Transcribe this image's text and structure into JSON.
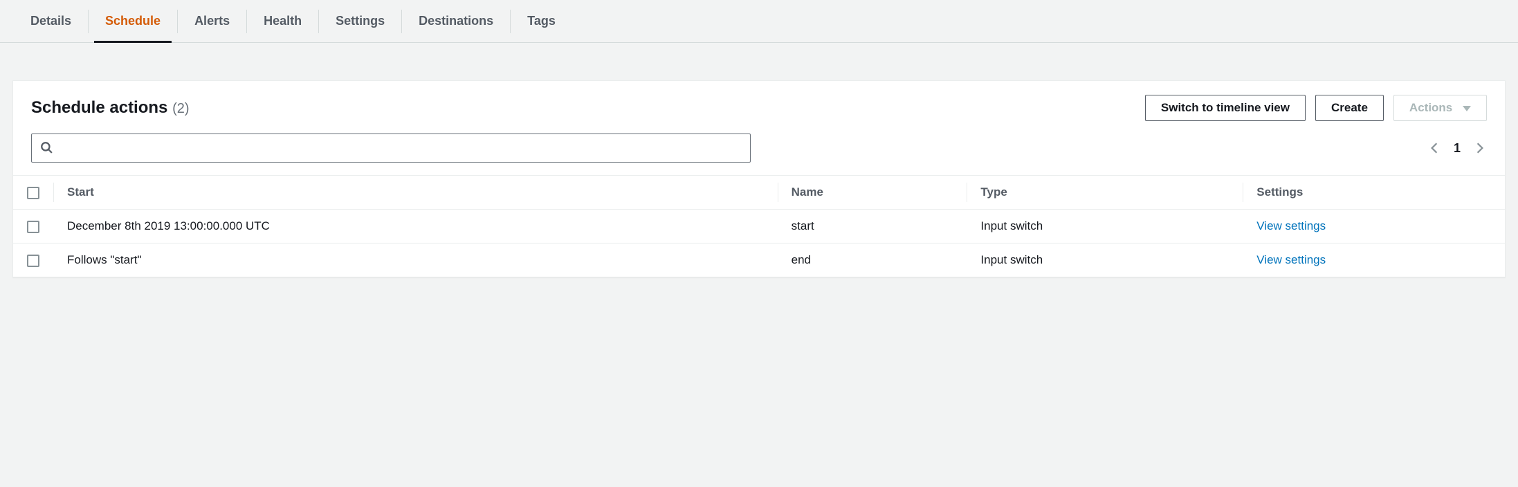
{
  "tabs": {
    "items": [
      {
        "label": "Details",
        "active": false
      },
      {
        "label": "Schedule",
        "active": true
      },
      {
        "label": "Alerts",
        "active": false
      },
      {
        "label": "Health",
        "active": false
      },
      {
        "label": "Settings",
        "active": false
      },
      {
        "label": "Destinations",
        "active": false
      },
      {
        "label": "Tags",
        "active": false
      }
    ]
  },
  "panel": {
    "title": "Schedule actions",
    "count_label": "(2)",
    "buttons": {
      "switch_view": "Switch to timeline view",
      "create": "Create",
      "actions": "Actions"
    }
  },
  "search": {
    "placeholder": ""
  },
  "pagination": {
    "current": "1"
  },
  "table": {
    "headers": {
      "start": "Start",
      "name": "Name",
      "type": "Type",
      "settings": "Settings"
    },
    "rows": [
      {
        "start": "December 8th 2019 13:00:00.000 UTC",
        "name": "start",
        "type": "Input switch",
        "settings": "View settings"
      },
      {
        "start": "Follows \"start\"",
        "name": "end",
        "type": "Input switch",
        "settings": "View settings"
      }
    ]
  }
}
